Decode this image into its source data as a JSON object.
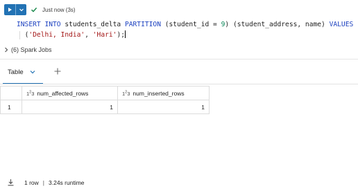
{
  "toolbar": {
    "status": "Just now (3s)",
    "accent": "#2272b4"
  },
  "code": {
    "line1": {
      "kw1": "INSERT",
      "kw2": "INTO",
      "table": "students_delta",
      "kw3": "PARTITION",
      "part_open": "(student_id = ",
      "part_val": "9",
      "part_close": ") (student_address, name) ",
      "kw4": "VALUES"
    },
    "line2": {
      "open": "(",
      "s1": "'Delhi, India'",
      "comma": ", ",
      "s2": "'Hari'",
      "close": ");"
    }
  },
  "spark_jobs": {
    "label": "(6) Spark Jobs"
  },
  "tabs": {
    "table_label": "Table"
  },
  "result_table": {
    "columns": [
      {
        "type_icon": "1",
        "type_sup": "2",
        "type_sub": "3",
        "name": "num_affected_rows"
      },
      {
        "type_icon": "1",
        "type_sup": "2",
        "type_sub": "3",
        "name": "num_inserted_rows"
      }
    ],
    "rows": [
      {
        "index": "1",
        "values": [
          "1",
          "1"
        ]
      }
    ]
  },
  "footer": {
    "rows": "1 row",
    "separator": "|",
    "runtime": "3.24s runtime"
  }
}
